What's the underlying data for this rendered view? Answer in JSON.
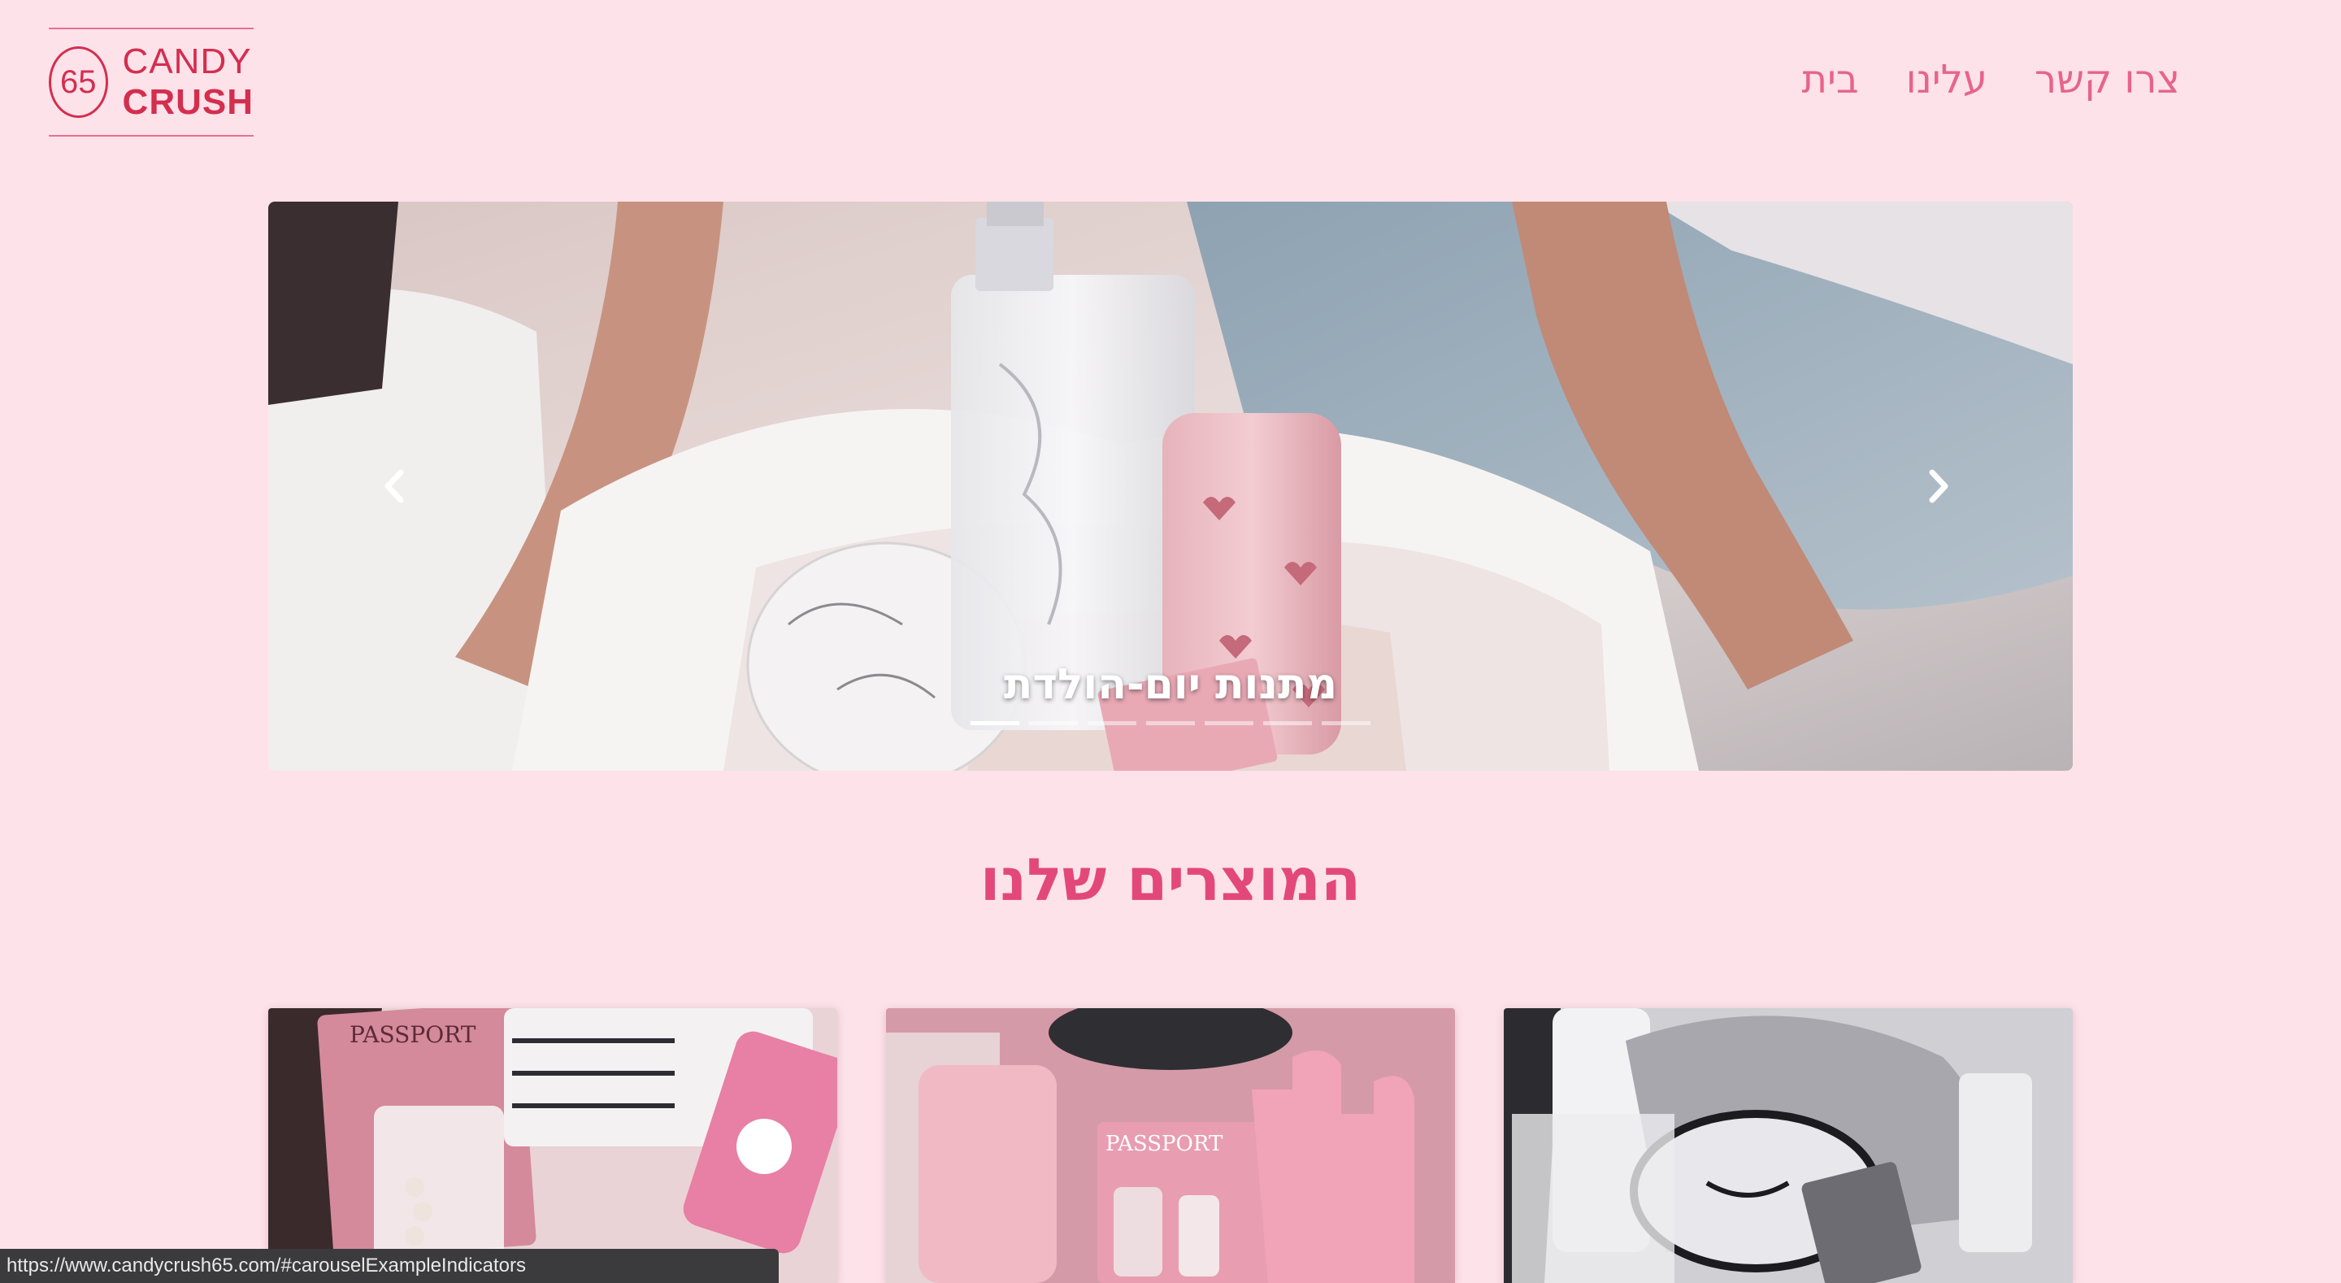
{
  "logo": {
    "number": "65",
    "line1": "CANDY",
    "line2": "CRUSH"
  },
  "nav": {
    "items": [
      "בית",
      "עלינו",
      "צרו קשר"
    ]
  },
  "carousel": {
    "caption": "מתנות יום-הולדת",
    "indicator_count": 7,
    "active_index": 0
  },
  "products": {
    "title": "המוצרים שלנו"
  },
  "status_bar": {
    "url": "https://www.candycrush65.com/#carouselExampleIndicators"
  },
  "colors": {
    "background": "#fde2ea",
    "brand_red": "#d42e4f",
    "accent_pink": "#e3487a",
    "nav_pink": "#e6648a"
  }
}
